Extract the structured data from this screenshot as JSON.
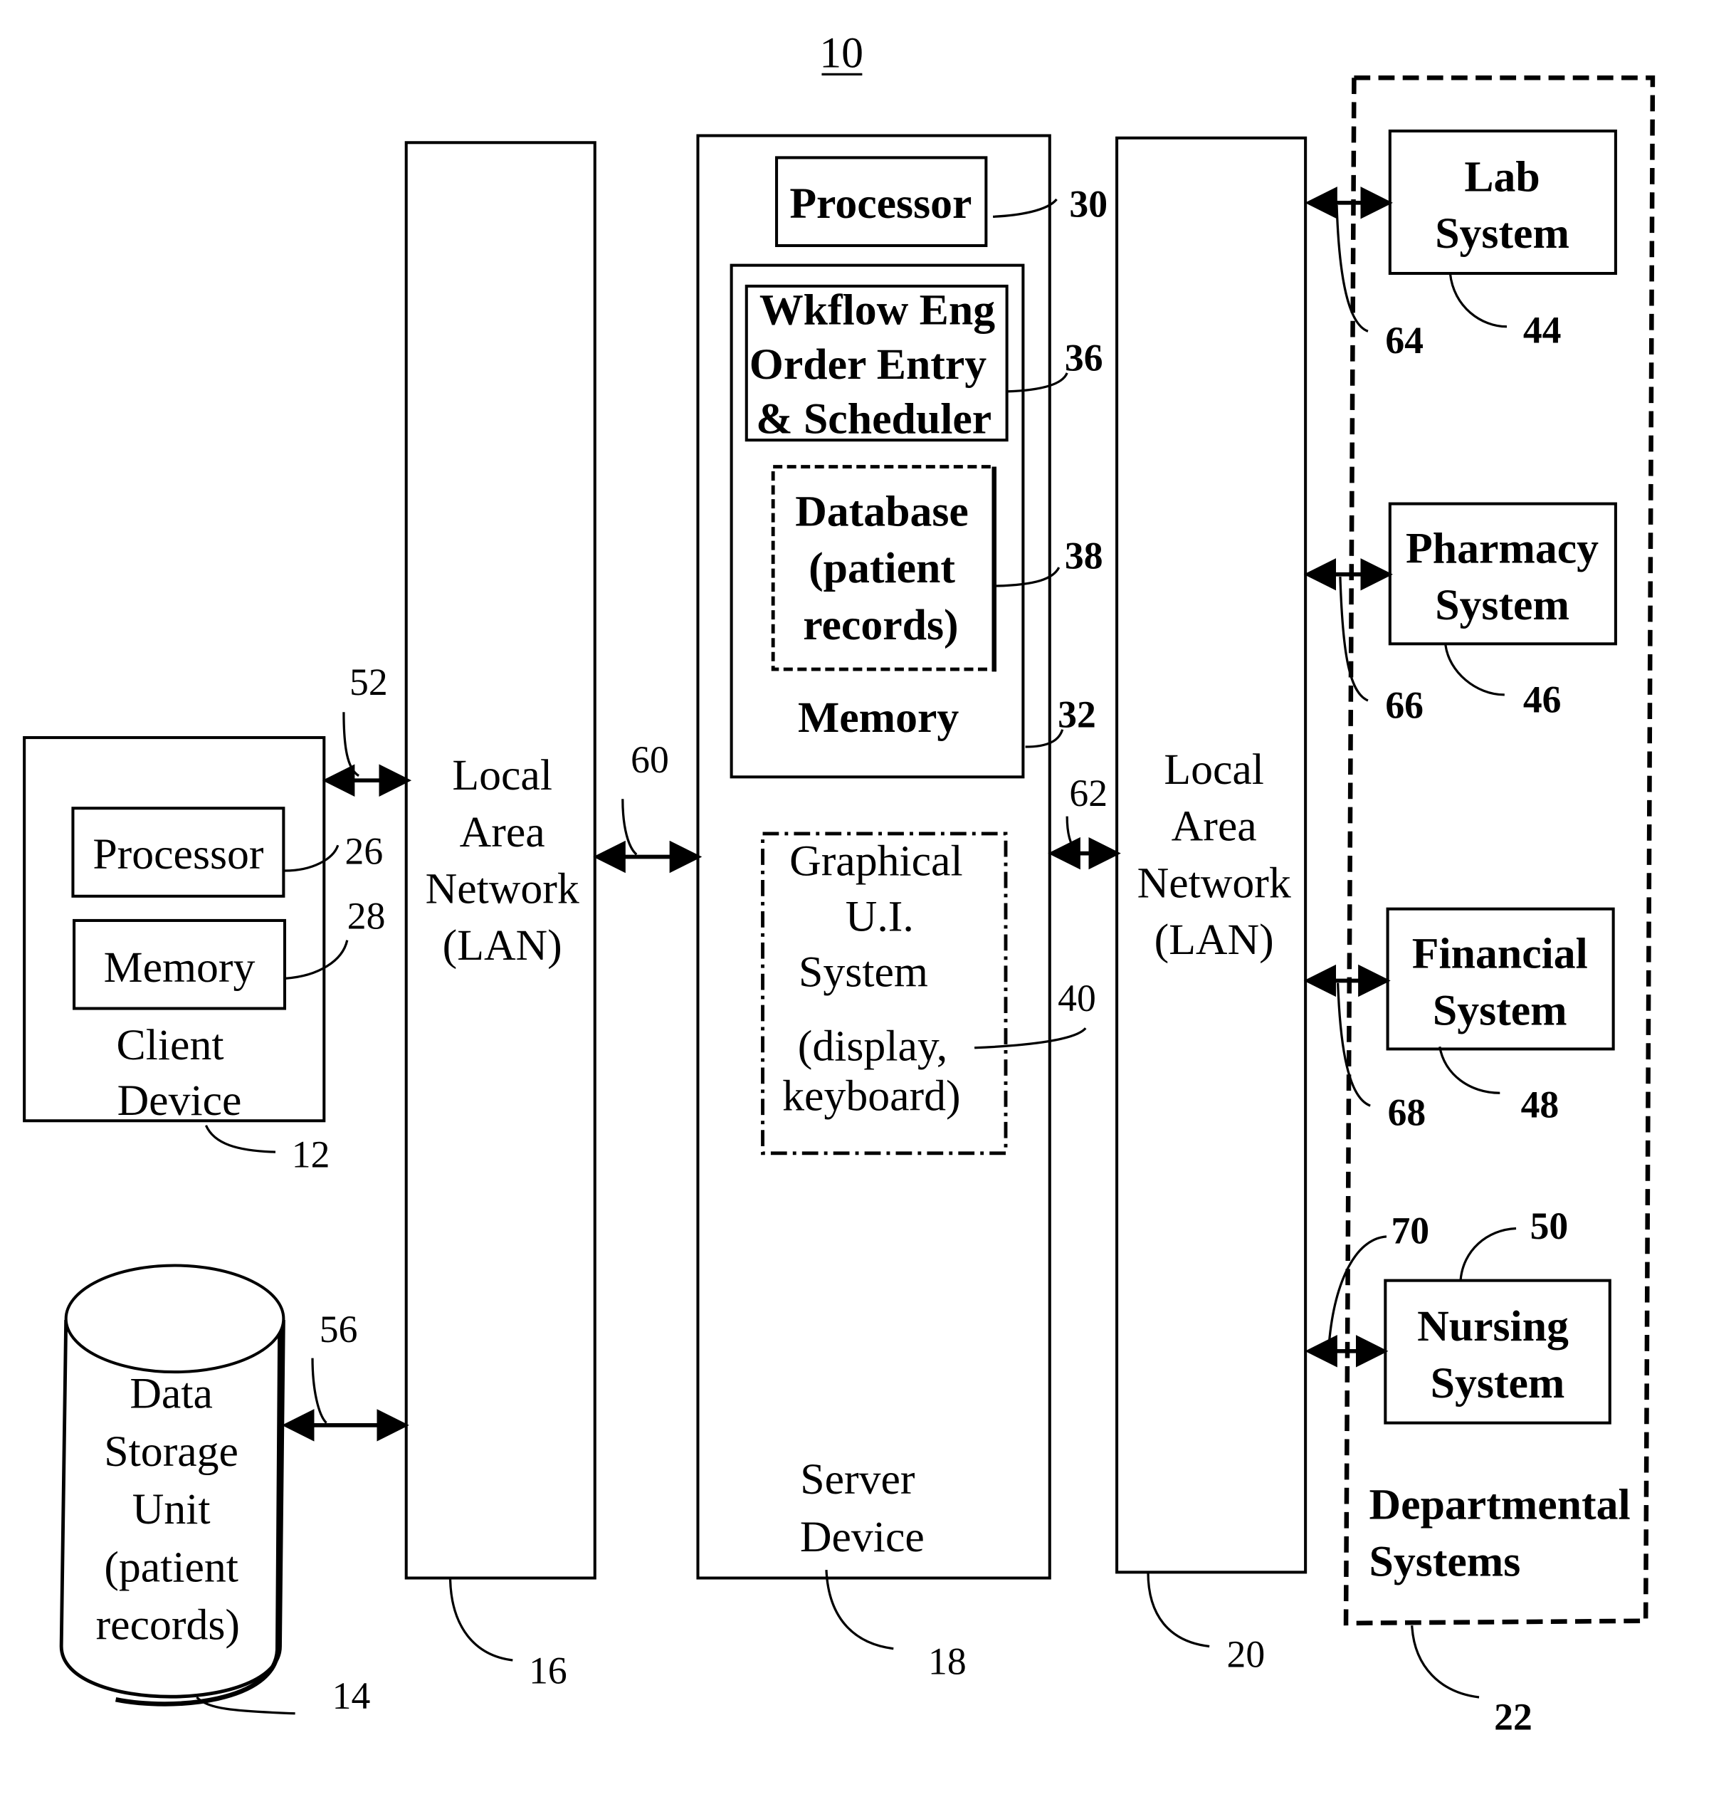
{
  "figure_ref": "10",
  "client_device": {
    "processor_label": "Processor",
    "memory_label": "Memory",
    "title_lines": [
      "Client",
      "Device"
    ],
    "ref": "12",
    "processor_ref": "26",
    "memory_ref": "28"
  },
  "data_storage": {
    "lines": [
      "Data",
      "Storage",
      "Unit",
      "(patient",
      "records)"
    ],
    "ref": "14"
  },
  "lan_left": {
    "lines": [
      "Local",
      "Area",
      "Network",
      "(LAN)"
    ],
    "ref": "16"
  },
  "server": {
    "processor_label": "Processor",
    "processor_ref": "30",
    "workflow_lines": [
      "Wkflow Eng",
      "Order Entry",
      "& Scheduler"
    ],
    "workflow_ref": "36",
    "database_lines": [
      "Database",
      "(patient",
      "records)"
    ],
    "database_ref": "38",
    "memory_label": "Memory",
    "memory_ref": "32",
    "gui_lines": [
      "Graphical",
      "U.I.",
      "System",
      "(display,",
      "keyboard)"
    ],
    "gui_ref": "40",
    "title_lines": [
      "Server",
      "Device"
    ],
    "ref": "18"
  },
  "lan_right": {
    "lines": [
      "Local",
      "Area",
      "Network",
      "(LAN)"
    ],
    "ref": "20"
  },
  "departmental": {
    "title_lines": [
      "Departmental",
      "Systems"
    ],
    "ref": "22",
    "systems": [
      {
        "lines": [
          "Lab",
          "System"
        ],
        "ref": "44",
        "link_ref": "64"
      },
      {
        "lines": [
          "Pharmacy",
          "System"
        ],
        "ref": "46",
        "link_ref": "66"
      },
      {
        "lines": [
          "Financial",
          "System"
        ],
        "ref": "48",
        "link_ref": "68"
      },
      {
        "lines": [
          "Nursing",
          "System"
        ],
        "ref": "50",
        "link_ref": "70"
      }
    ]
  },
  "links": {
    "client_to_lan": "52",
    "storage_to_lan": "56",
    "lan_to_server": "60",
    "server_to_lan": "62"
  }
}
